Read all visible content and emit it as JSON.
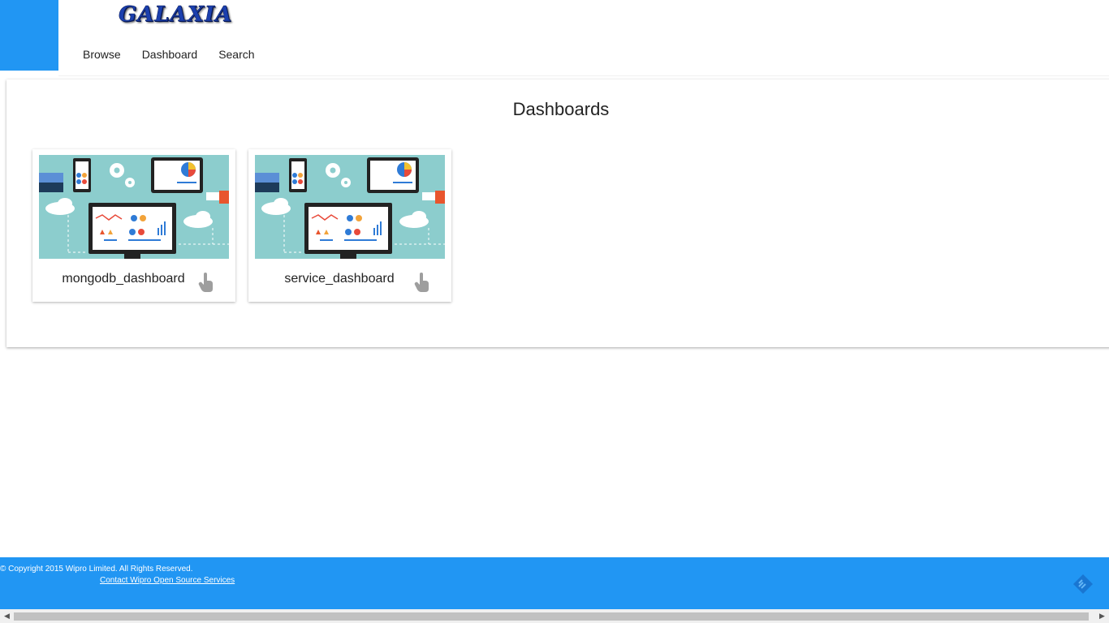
{
  "brand": {
    "logo_text": "GALAXIA",
    "accent": "#2196f3"
  },
  "nav": {
    "items": [
      {
        "label": "Browse"
      },
      {
        "label": "Dashboard"
      },
      {
        "label": "Search"
      }
    ]
  },
  "main": {
    "title": "Dashboards",
    "cards": [
      {
        "label": "mongodb_dashboard",
        "icon": "pointer-hand-icon"
      },
      {
        "label": "service_dashboard",
        "icon": "pointer-hand-icon"
      }
    ]
  },
  "footer": {
    "copyright": "© Copyright 2015 Wipro Limited. All Rights Reserved.",
    "contact_link": "Contact Wipro Open Source Services",
    "icon": "feed-icon"
  },
  "scrollbar": {
    "left_arrow": "◀",
    "right_arrow": "▶"
  }
}
